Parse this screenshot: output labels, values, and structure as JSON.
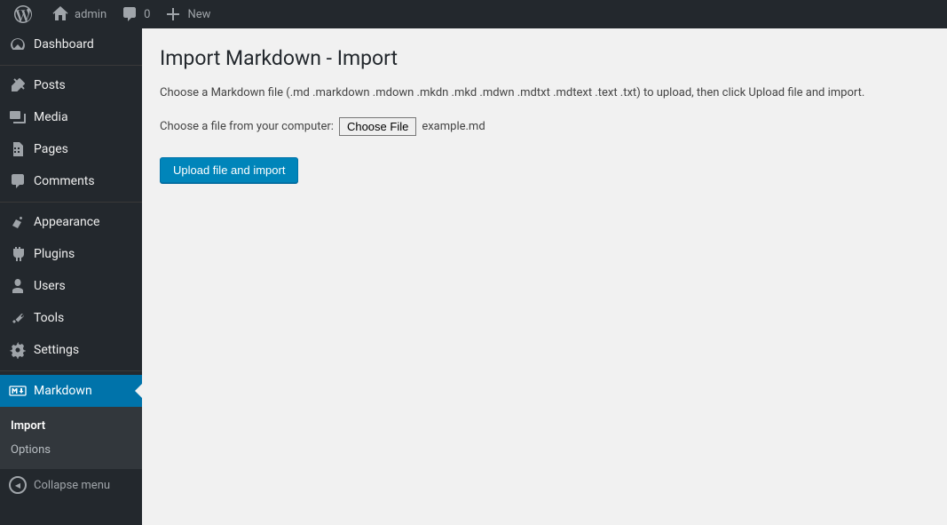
{
  "adminbar": {
    "site_name": "admin",
    "comments_count": "0",
    "new_label": "New"
  },
  "sidebar": {
    "items": [
      {
        "label": "Dashboard"
      },
      {
        "label": "Posts"
      },
      {
        "label": "Media"
      },
      {
        "label": "Pages"
      },
      {
        "label": "Comments"
      },
      {
        "label": "Appearance"
      },
      {
        "label": "Plugins"
      },
      {
        "label": "Users"
      },
      {
        "label": "Tools"
      },
      {
        "label": "Settings"
      },
      {
        "label": "Markdown"
      }
    ],
    "submenu": [
      {
        "label": "Import"
      },
      {
        "label": "Options"
      }
    ],
    "collapse_label": "Collapse menu"
  },
  "main": {
    "title": "Import Markdown - Import",
    "description": "Choose a Markdown file (.md .markdown .mdown .mkdn .mkd .mdwn .mdtxt .mdtext .text .txt) to upload, then click Upload file and import.",
    "file_prompt": "Choose a file from your computer:",
    "choose_file_label": "Choose File",
    "selected_filename": "example.md",
    "submit_label": "Upload file and import"
  }
}
